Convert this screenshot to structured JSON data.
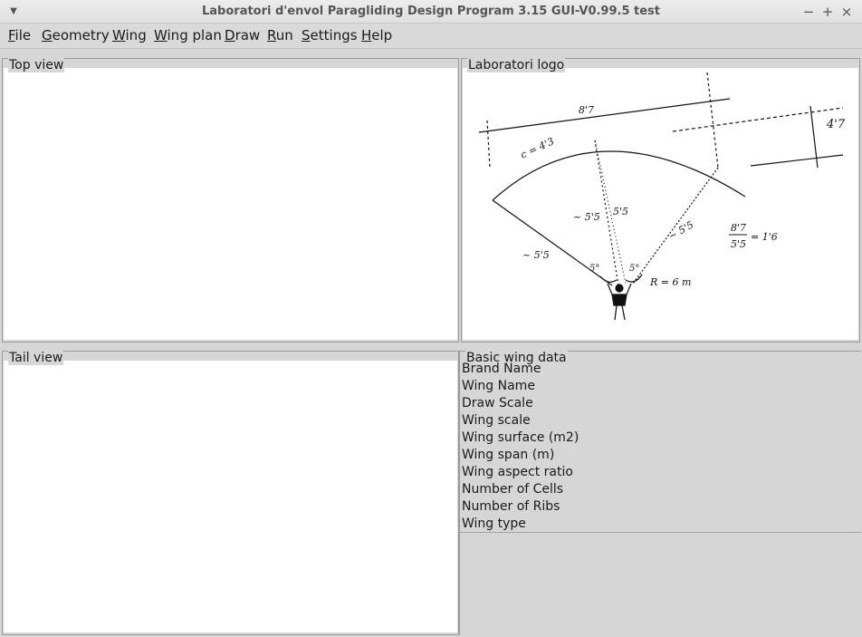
{
  "window": {
    "title": "Laboratori d'envol Paragliding Design Program 3.15 GUI-V0.99.5 test",
    "menu_arrow_icon": "chevron-down-icon",
    "minimize_glyph": "−",
    "maximize_glyph": "+",
    "close_glyph": "×"
  },
  "menubar": {
    "items": [
      {
        "label": "File"
      },
      {
        "label": "Geometry"
      },
      {
        "label": "Wing"
      },
      {
        "label": "Wing plan"
      },
      {
        "label": "Draw"
      },
      {
        "label": "Run"
      },
      {
        "label": "Settings"
      },
      {
        "label": "Help"
      }
    ]
  },
  "panels": {
    "top_view": {
      "title": "Top view"
    },
    "logo": {
      "title": "Laboratori logo"
    },
    "tail_view": {
      "title": "Tail view"
    },
    "basic_wing_data": {
      "title": "Basic wing data",
      "rows": [
        "Brand Name",
        "Wing Name",
        "Draw Scale",
        "Wing scale",
        "Wing surface (m2)",
        "Wing span (m)",
        "Wing aspect ratio",
        "Number of Cells",
        "Number of Ribs",
        "Wing type"
      ]
    }
  }
}
